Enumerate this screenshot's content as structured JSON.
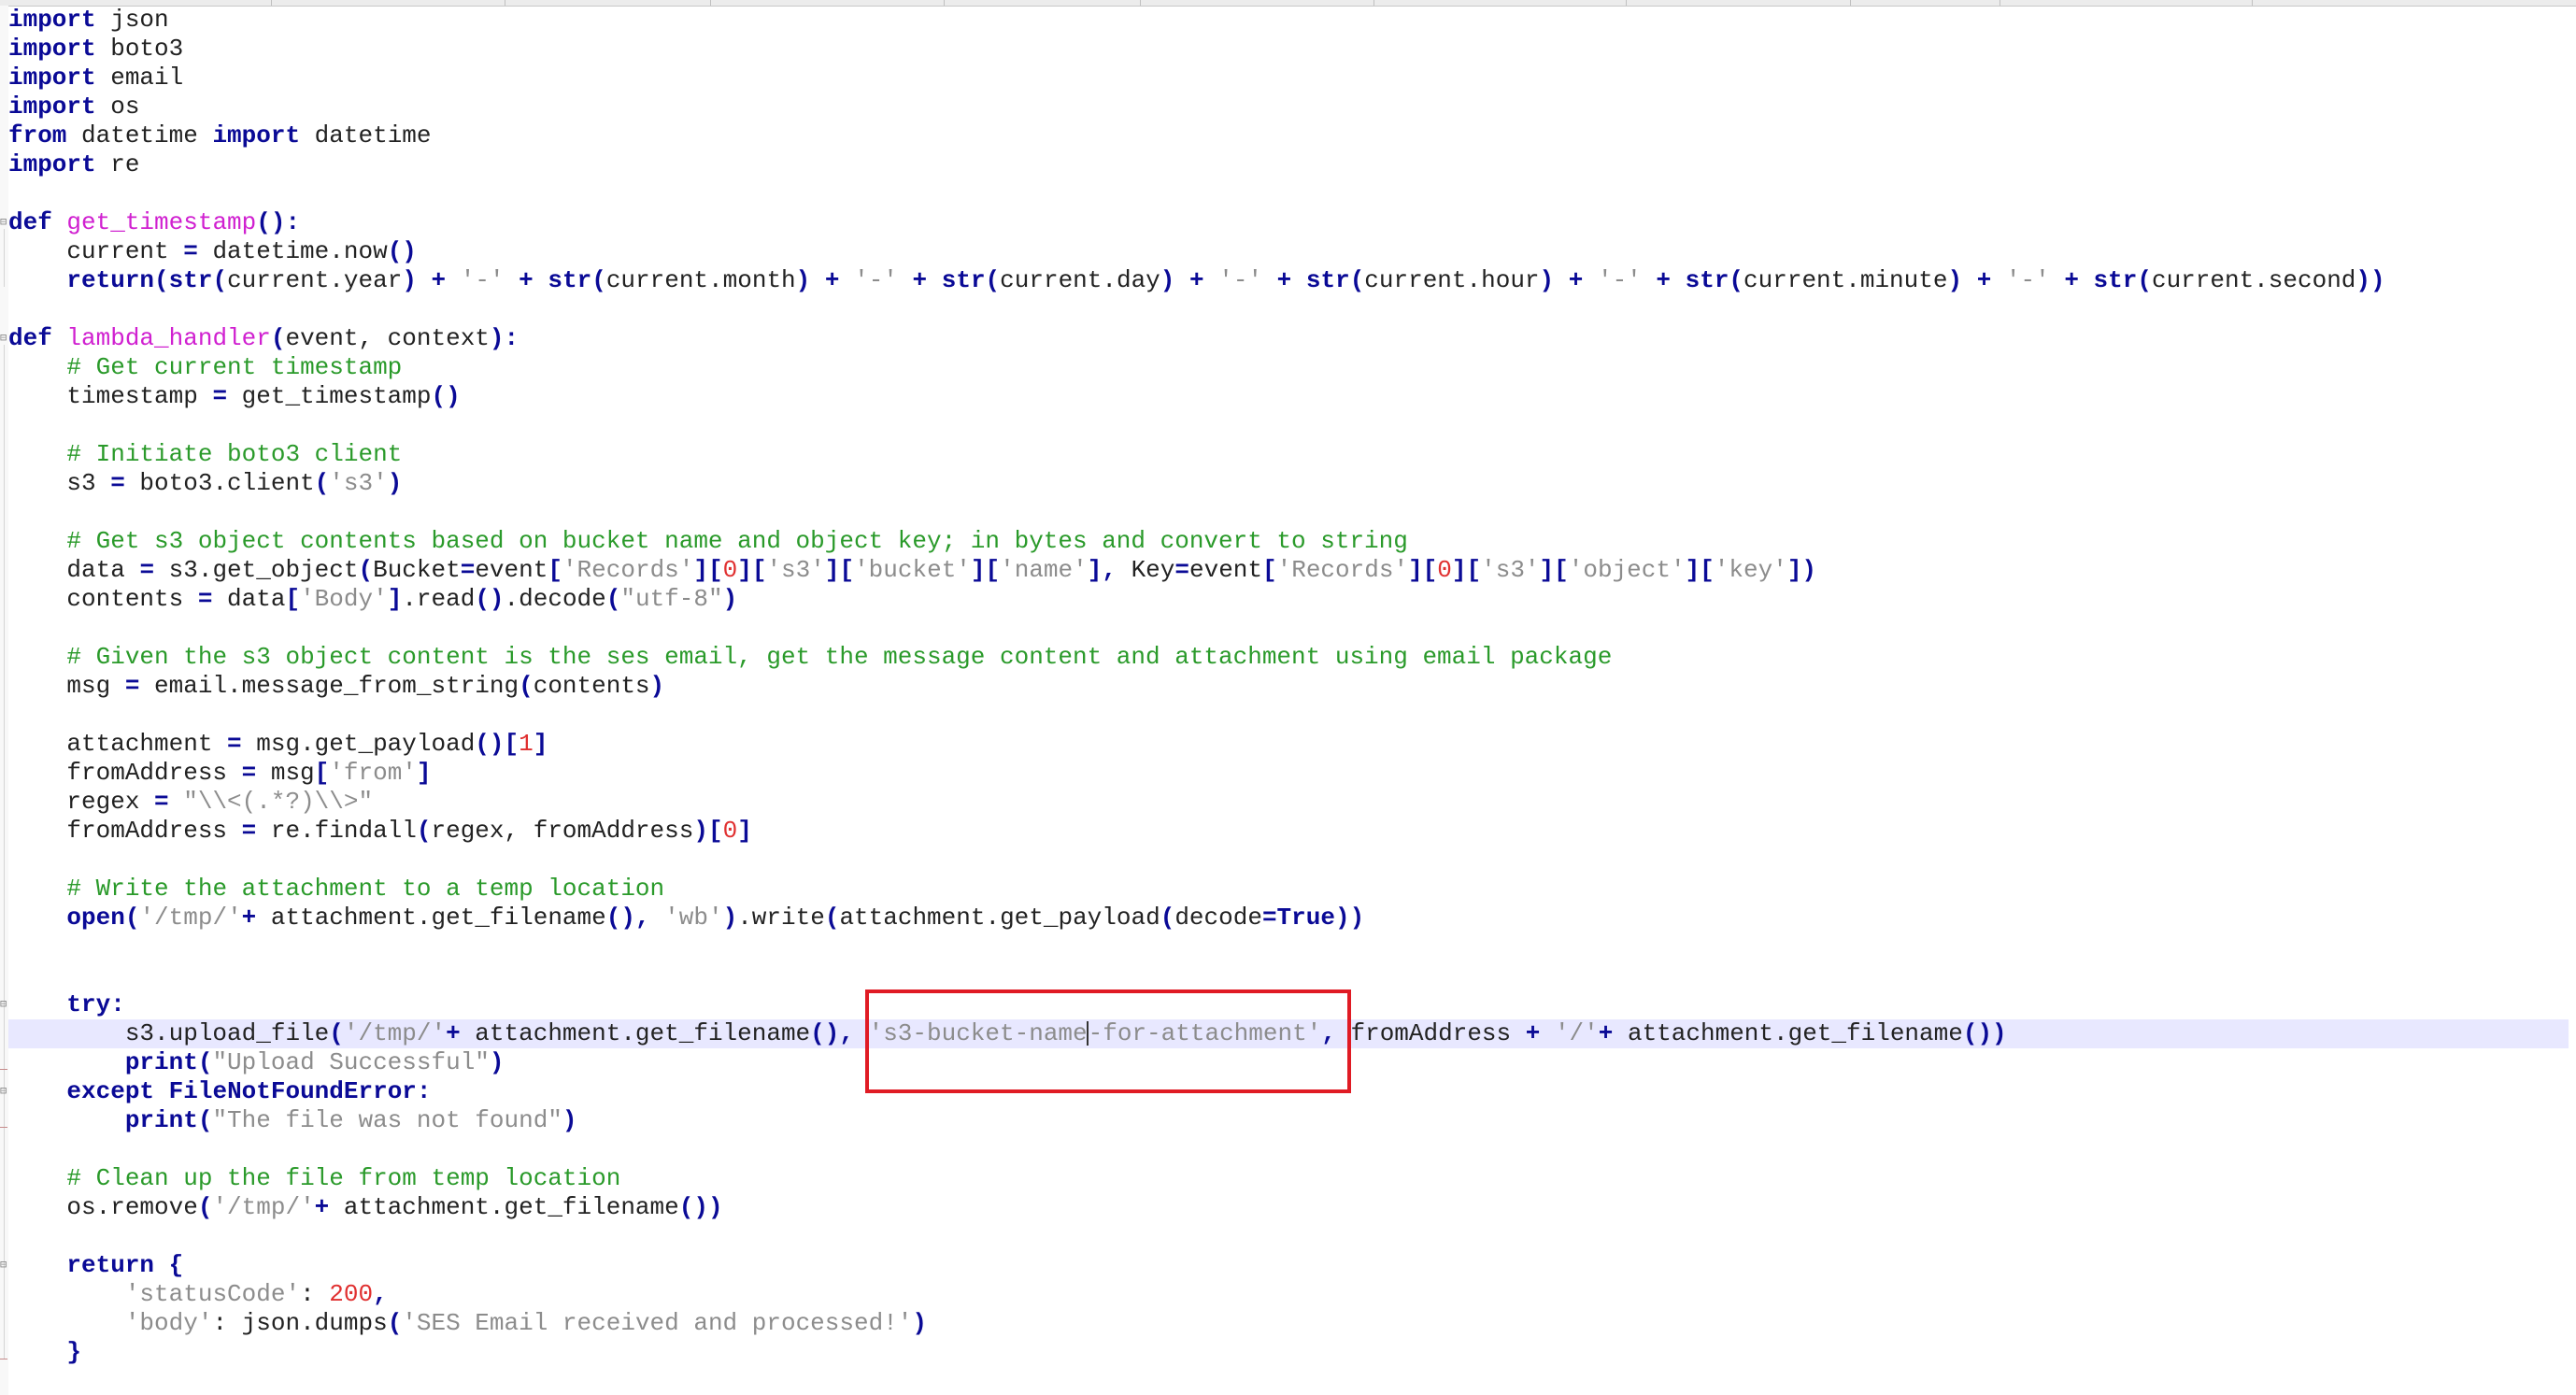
{
  "editor": {
    "lines": [
      [
        {
          "t": "import",
          "c": "kw"
        },
        {
          "t": " json"
        }
      ],
      [
        {
          "t": "import",
          "c": "kw"
        },
        {
          "t": " boto3"
        }
      ],
      [
        {
          "t": "import",
          "c": "kw"
        },
        {
          "t": " email"
        }
      ],
      [
        {
          "t": "import",
          "c": "kw"
        },
        {
          "t": " os"
        }
      ],
      [
        {
          "t": "from",
          "c": "kw"
        },
        {
          "t": " datetime "
        },
        {
          "t": "import",
          "c": "kw"
        },
        {
          "t": " datetime"
        }
      ],
      [
        {
          "t": "import",
          "c": "kw"
        },
        {
          "t": " re"
        }
      ],
      [],
      [
        {
          "t": "def",
          "c": "kw"
        },
        {
          "t": " "
        },
        {
          "t": "get_timestamp",
          "c": "fn"
        },
        {
          "t": "():",
          "c": "pn"
        }
      ],
      [
        {
          "t": "    current "
        },
        {
          "t": "=",
          "c": "op"
        },
        {
          "t": " datetime.now"
        },
        {
          "t": "()",
          "c": "pn"
        }
      ],
      [
        {
          "t": "    "
        },
        {
          "t": "return",
          "c": "kw"
        },
        {
          "t": "(",
          "c": "pn"
        },
        {
          "t": "str",
          "c": "kw"
        },
        {
          "t": "(",
          "c": "pn"
        },
        {
          "t": "current.year"
        },
        {
          "t": ")",
          "c": "pn"
        },
        {
          "t": " "
        },
        {
          "t": "+",
          "c": "op"
        },
        {
          "t": " "
        },
        {
          "t": "'-'",
          "c": "st"
        },
        {
          "t": " "
        },
        {
          "t": "+",
          "c": "op"
        },
        {
          "t": " "
        },
        {
          "t": "str",
          "c": "kw"
        },
        {
          "t": "(",
          "c": "pn"
        },
        {
          "t": "current.month"
        },
        {
          "t": ")",
          "c": "pn"
        },
        {
          "t": " "
        },
        {
          "t": "+",
          "c": "op"
        },
        {
          "t": " "
        },
        {
          "t": "'-'",
          "c": "st"
        },
        {
          "t": " "
        },
        {
          "t": "+",
          "c": "op"
        },
        {
          "t": " "
        },
        {
          "t": "str",
          "c": "kw"
        },
        {
          "t": "(",
          "c": "pn"
        },
        {
          "t": "current.day"
        },
        {
          "t": ")",
          "c": "pn"
        },
        {
          "t": " "
        },
        {
          "t": "+",
          "c": "op"
        },
        {
          "t": " "
        },
        {
          "t": "'-'",
          "c": "st"
        },
        {
          "t": " "
        },
        {
          "t": "+",
          "c": "op"
        },
        {
          "t": " "
        },
        {
          "t": "str",
          "c": "kw"
        },
        {
          "t": "(",
          "c": "pn"
        },
        {
          "t": "current.hour"
        },
        {
          "t": ")",
          "c": "pn"
        },
        {
          "t": " "
        },
        {
          "t": "+",
          "c": "op"
        },
        {
          "t": " "
        },
        {
          "t": "'-'",
          "c": "st"
        },
        {
          "t": " "
        },
        {
          "t": "+",
          "c": "op"
        },
        {
          "t": " "
        },
        {
          "t": "str",
          "c": "kw"
        },
        {
          "t": "(",
          "c": "pn"
        },
        {
          "t": "current.minute"
        },
        {
          "t": ")",
          "c": "pn"
        },
        {
          "t": " "
        },
        {
          "t": "+",
          "c": "op"
        },
        {
          "t": " "
        },
        {
          "t": "'-'",
          "c": "st"
        },
        {
          "t": " "
        },
        {
          "t": "+",
          "c": "op"
        },
        {
          "t": " "
        },
        {
          "t": "str",
          "c": "kw"
        },
        {
          "t": "(",
          "c": "pn"
        },
        {
          "t": "current.second"
        },
        {
          "t": "))",
          "c": "pn"
        }
      ],
      [],
      [
        {
          "t": "def",
          "c": "kw"
        },
        {
          "t": " "
        },
        {
          "t": "lambda_handler",
          "c": "fn"
        },
        {
          "t": "(",
          "c": "pn"
        },
        {
          "t": "event, context"
        },
        {
          "t": "):",
          "c": "pn"
        }
      ],
      [
        {
          "t": "    "
        },
        {
          "t": "# Get current timestamp",
          "c": "cm"
        }
      ],
      [
        {
          "t": "    timestamp "
        },
        {
          "t": "=",
          "c": "op"
        },
        {
          "t": " get_timestamp"
        },
        {
          "t": "()",
          "c": "pn"
        }
      ],
      [],
      [
        {
          "t": "    "
        },
        {
          "t": "# Initiate boto3 client",
          "c": "cm"
        }
      ],
      [
        {
          "t": "    s3 "
        },
        {
          "t": "=",
          "c": "op"
        },
        {
          "t": " boto3.client"
        },
        {
          "t": "(",
          "c": "pn"
        },
        {
          "t": "'s3'",
          "c": "st"
        },
        {
          "t": ")",
          "c": "pn"
        }
      ],
      [],
      [
        {
          "t": "    "
        },
        {
          "t": "# Get s3 object contents based on bucket name and object key; in bytes and convert to string",
          "c": "cm"
        }
      ],
      [
        {
          "t": "    data "
        },
        {
          "t": "=",
          "c": "op"
        },
        {
          "t": " s3.get_object"
        },
        {
          "t": "(",
          "c": "pn"
        },
        {
          "t": "Bucket"
        },
        {
          "t": "=",
          "c": "op"
        },
        {
          "t": "event"
        },
        {
          "t": "[",
          "c": "pn"
        },
        {
          "t": "'Records'",
          "c": "st"
        },
        {
          "t": "][",
          "c": "pn"
        },
        {
          "t": "0",
          "c": "nm"
        },
        {
          "t": "][",
          "c": "pn"
        },
        {
          "t": "'s3'",
          "c": "st"
        },
        {
          "t": "][",
          "c": "pn"
        },
        {
          "t": "'bucket'",
          "c": "st"
        },
        {
          "t": "][",
          "c": "pn"
        },
        {
          "t": "'name'",
          "c": "st"
        },
        {
          "t": "],",
          "c": "pn"
        },
        {
          "t": " Key"
        },
        {
          "t": "=",
          "c": "op"
        },
        {
          "t": "event"
        },
        {
          "t": "[",
          "c": "pn"
        },
        {
          "t": "'Records'",
          "c": "st"
        },
        {
          "t": "][",
          "c": "pn"
        },
        {
          "t": "0",
          "c": "nm"
        },
        {
          "t": "][",
          "c": "pn"
        },
        {
          "t": "'s3'",
          "c": "st"
        },
        {
          "t": "][",
          "c": "pn"
        },
        {
          "t": "'object'",
          "c": "st"
        },
        {
          "t": "][",
          "c": "pn"
        },
        {
          "t": "'key'",
          "c": "st"
        },
        {
          "t": "])",
          "c": "pn"
        }
      ],
      [
        {
          "t": "    contents "
        },
        {
          "t": "=",
          "c": "op"
        },
        {
          "t": " data"
        },
        {
          "t": "[",
          "c": "pn"
        },
        {
          "t": "'Body'",
          "c": "st"
        },
        {
          "t": "]",
          "c": "pn"
        },
        {
          "t": ".read"
        },
        {
          "t": "()",
          "c": "pn"
        },
        {
          "t": ".decode"
        },
        {
          "t": "(",
          "c": "pn"
        },
        {
          "t": "\"utf-8\"",
          "c": "st"
        },
        {
          "t": ")",
          "c": "pn"
        }
      ],
      [],
      [
        {
          "t": "    "
        },
        {
          "t": "# Given the s3 object content is the ses email, get the message content and attachment using email package",
          "c": "cm"
        }
      ],
      [
        {
          "t": "    msg "
        },
        {
          "t": "=",
          "c": "op"
        },
        {
          "t": " email.message_from_string"
        },
        {
          "t": "(",
          "c": "pn"
        },
        {
          "t": "contents"
        },
        {
          "t": ")",
          "c": "pn"
        }
      ],
      [],
      [
        {
          "t": "    attachment "
        },
        {
          "t": "=",
          "c": "op"
        },
        {
          "t": " msg.get_payload"
        },
        {
          "t": "()[",
          "c": "pn"
        },
        {
          "t": "1",
          "c": "nm"
        },
        {
          "t": "]",
          "c": "pn"
        }
      ],
      [
        {
          "t": "    fromAddress "
        },
        {
          "t": "=",
          "c": "op"
        },
        {
          "t": " msg"
        },
        {
          "t": "[",
          "c": "pn"
        },
        {
          "t": "'from'",
          "c": "st"
        },
        {
          "t": "]",
          "c": "pn"
        }
      ],
      [
        {
          "t": "    regex "
        },
        {
          "t": "=",
          "c": "op"
        },
        {
          "t": " "
        },
        {
          "t": "\"\\\\<(.*?)\\\\>\"",
          "c": "st"
        }
      ],
      [
        {
          "t": "    fromAddress "
        },
        {
          "t": "=",
          "c": "op"
        },
        {
          "t": " re.findall"
        },
        {
          "t": "(",
          "c": "pn"
        },
        {
          "t": "regex, fromAddress"
        },
        {
          "t": ")[",
          "c": "pn"
        },
        {
          "t": "0",
          "c": "nm"
        },
        {
          "t": "]",
          "c": "pn"
        }
      ],
      [],
      [
        {
          "t": "    "
        },
        {
          "t": "# Write the attachment to a temp location",
          "c": "cm"
        }
      ],
      [
        {
          "t": "    "
        },
        {
          "t": "open",
          "c": "kw"
        },
        {
          "t": "(",
          "c": "pn"
        },
        {
          "t": "'/tmp/'",
          "c": "st"
        },
        {
          "t": "+",
          "c": "op"
        },
        {
          "t": " attachment.get_filename"
        },
        {
          "t": "(),",
          "c": "pn"
        },
        {
          "t": " "
        },
        {
          "t": "'wb'",
          "c": "st"
        },
        {
          "t": ")",
          "c": "pn"
        },
        {
          "t": ".write"
        },
        {
          "t": "(",
          "c": "pn"
        },
        {
          "t": "attachment.get_payload"
        },
        {
          "t": "(",
          "c": "pn"
        },
        {
          "t": "decode"
        },
        {
          "t": "=",
          "c": "op"
        },
        {
          "t": "True",
          "c": "kw"
        },
        {
          "t": "))",
          "c": "pn"
        }
      ],
      [],
      [],
      [
        {
          "t": "    "
        },
        {
          "t": "try",
          "c": "kw"
        },
        {
          "t": ":",
          "c": "pn"
        }
      ],
      [
        {
          "t": "        s3.upload_file"
        },
        {
          "t": "(",
          "c": "pn"
        },
        {
          "t": "'/tmp/'",
          "c": "st"
        },
        {
          "t": "+",
          "c": "op"
        },
        {
          "t": " attachment.get_filename"
        },
        {
          "t": "(),",
          "c": "pn"
        },
        {
          "t": " "
        },
        {
          "t": "'s3-bucket-name",
          "c": "st"
        },
        {
          "t": "",
          "c": "caret"
        },
        {
          "t": "-for-attachment'",
          "c": "st"
        },
        {
          "t": ",",
          "c": "pn"
        },
        {
          "t": " fromAddress "
        },
        {
          "t": "+",
          "c": "op"
        },
        {
          "t": " "
        },
        {
          "t": "'/'",
          "c": "st"
        },
        {
          "t": "+",
          "c": "op"
        },
        {
          "t": " attachment.get_filename"
        },
        {
          "t": "())",
          "c": "pn"
        }
      ],
      [
        {
          "t": "        "
        },
        {
          "t": "print",
          "c": "kw"
        },
        {
          "t": "(",
          "c": "pn"
        },
        {
          "t": "\"Upload Successful\"",
          "c": "st"
        },
        {
          "t": ")",
          "c": "pn"
        }
      ],
      [
        {
          "t": "    "
        },
        {
          "t": "except",
          "c": "kw"
        },
        {
          "t": " "
        },
        {
          "t": "FileNotFoundError",
          "c": "kw"
        },
        {
          "t": ":",
          "c": "pn"
        }
      ],
      [
        {
          "t": "        "
        },
        {
          "t": "print",
          "c": "kw"
        },
        {
          "t": "(",
          "c": "pn"
        },
        {
          "t": "\"The file was not found\"",
          "c": "st"
        },
        {
          "t": ")",
          "c": "pn"
        }
      ],
      [],
      [
        {
          "t": "    "
        },
        {
          "t": "# Clean up the file from temp location",
          "c": "cm"
        }
      ],
      [
        {
          "t": "    os.remove"
        },
        {
          "t": "(",
          "c": "pn"
        },
        {
          "t": "'/tmp/'",
          "c": "st"
        },
        {
          "t": "+",
          "c": "op"
        },
        {
          "t": " attachment.get_filename"
        },
        {
          "t": "())",
          "c": "pn"
        }
      ],
      [],
      [
        {
          "t": "    "
        },
        {
          "t": "return",
          "c": "kw"
        },
        {
          "t": " "
        },
        {
          "t": "{",
          "c": "pn"
        }
      ],
      [
        {
          "t": "        "
        },
        {
          "t": "'statusCode'",
          "c": "st"
        },
        {
          "t": ": "
        },
        {
          "t": "200",
          "c": "nm"
        },
        {
          "t": ",",
          "c": "pn"
        }
      ],
      [
        {
          "t": "        "
        },
        {
          "t": "'body'",
          "c": "st"
        },
        {
          "t": ": json.dumps"
        },
        {
          "t": "(",
          "c": "pn"
        },
        {
          "t": "'SES Email received and processed!'",
          "c": "st"
        },
        {
          "t": ")",
          "c": "pn"
        }
      ],
      [
        {
          "t": "    "
        },
        {
          "t": "}",
          "c": "pn"
        }
      ]
    ],
    "current_line_index": 35,
    "colors": {
      "keyword": "#0a0a96",
      "function_name": "#d020d0",
      "comment": "#2a9a2a",
      "string": "#8c8c8c",
      "number": "#e03030",
      "highlight_box": "#e01b24",
      "current_line": "#e8e8ff"
    }
  }
}
